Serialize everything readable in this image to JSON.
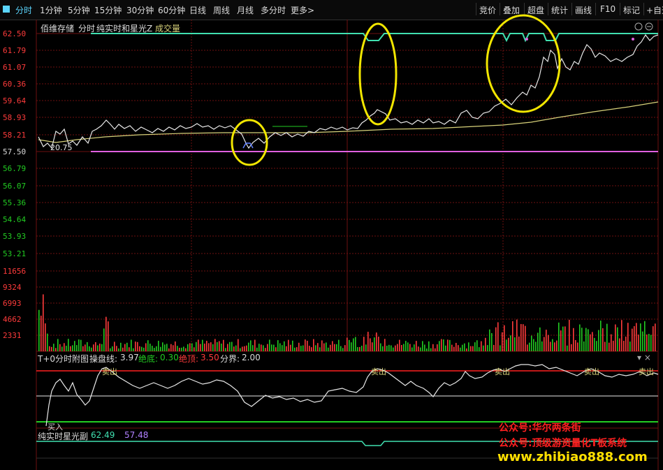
{
  "toolbar": {
    "tabs": [
      "分时",
      "1分钟",
      "5分钟",
      "15分钟",
      "30分钟",
      "60分钟",
      "日线",
      "周线",
      "月线",
      "多分时",
      "更多>"
    ],
    "right_tabs": [
      "竞价",
      "叠加",
      "超盘",
      "统计",
      "画线",
      "F10",
      "标记",
      "+自选"
    ]
  },
  "main": {
    "stock_name": "佰维存储",
    "mode": "分时",
    "indicator": "纯实时和星光Z",
    "volume_label": "成交量",
    "price_labels": [
      "62.50",
      "61.79",
      "61.07",
      "60.36",
      "59.64",
      "58.93",
      "58.21",
      "57.50",
      "56.79",
      "56.07",
      "55.36",
      "54.64",
      "53.93",
      "53.21"
    ],
    "inline_label": "20.75"
  },
  "volume": {
    "labels": [
      "11656",
      "9324",
      "6993",
      "4662",
      "2331"
    ]
  },
  "sub1": {
    "title": "T+0分时附图",
    "line_label": "操盘线:",
    "line_value": "3.97",
    "bottom_label": "绝底:",
    "bottom_value": "0.30",
    "top_label": "绝顶:",
    "top_value": "3.50",
    "divide_label": "分界:",
    "divide_value": "2.00",
    "sell_label": "卖出",
    "buy_label": "买入"
  },
  "sub2": {
    "title": "纯实时星光副",
    "v1": "62.49",
    "v2": "57.48"
  },
  "watermark": {
    "line1": "公众号:华尔两条街",
    "line2": "公众号:顶级游资量化T板系统",
    "line3": "www.zhibiao888.com"
  },
  "colors": {
    "up": "#ff3b3b",
    "down": "#22cc22",
    "accent": "#5cd6ff",
    "price_line": "#e8e8e8",
    "avg_line": "#d8d27a",
    "support": "#e060e0",
    "upper": "#40e0b0",
    "highlight": "#f2e600",
    "grid": "#6e1010"
  }
}
